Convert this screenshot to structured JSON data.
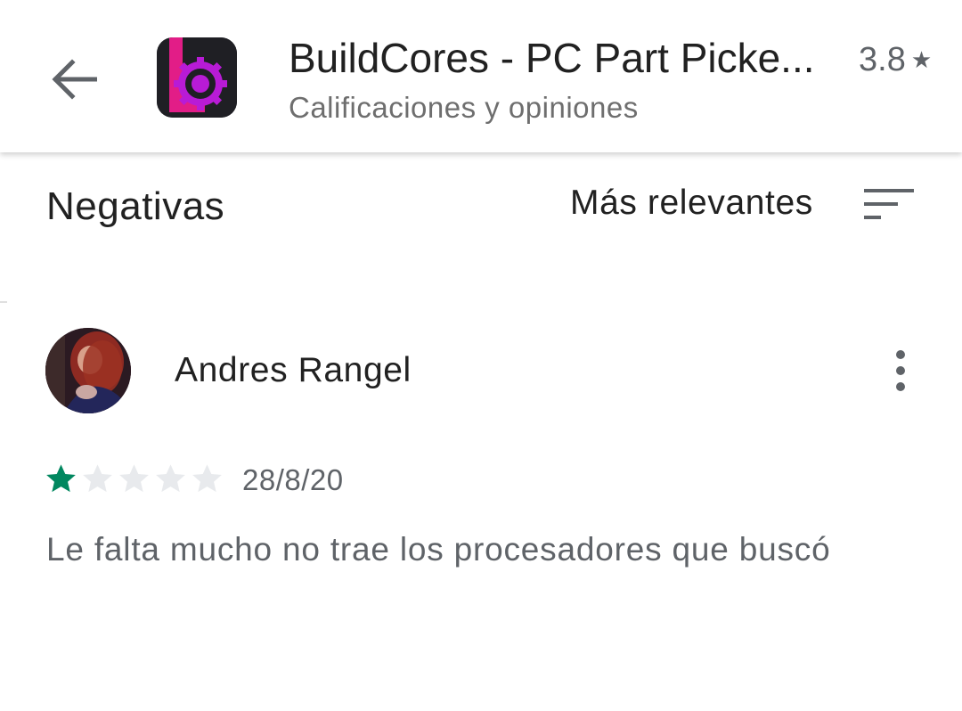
{
  "header": {
    "app_title": "BuildCores - PC Part Picke...",
    "subtitle": "Calificaciones y opiniones",
    "rating": "3.8",
    "back_icon": "arrow-back-icon",
    "rating_icon": "star-icon",
    "app_icon": "buildcores-app-icon"
  },
  "filters": {
    "selected_filter": "Negativas",
    "sort_label": "Más relevantes",
    "sort_icon": "sort-icon"
  },
  "review": {
    "author": "Andres Rangel",
    "rating": 1,
    "max_rating": 5,
    "date": "28/8/20",
    "text": "Le falta mucho no trae los procesadores que buscó",
    "more_icon": "more-vert-icon"
  },
  "colors": {
    "star_filled": "#01875f",
    "star_empty": "#e8eaed",
    "text_primary": "#212121",
    "text_secondary": "#5f6368",
    "app_icon_bg": "#1f1f24",
    "app_icon_accent": "#b81bd6"
  }
}
